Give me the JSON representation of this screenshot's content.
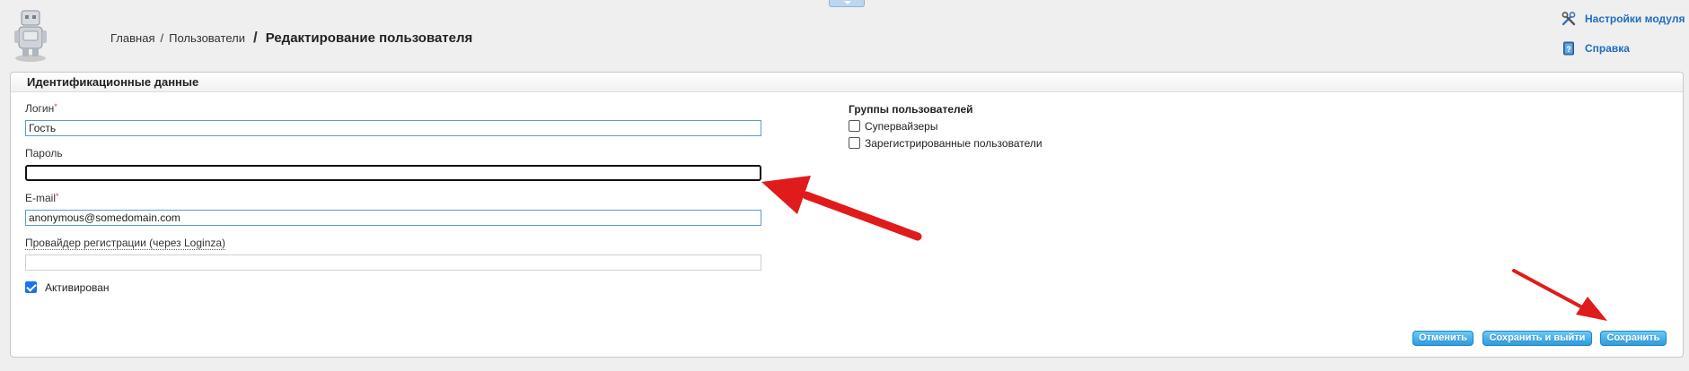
{
  "header": {
    "breadcrumb": [
      "Главная",
      "Пользователи"
    ],
    "current_page": "Редактирование пользователя",
    "links": {
      "settings": "Настройки модуля",
      "help": "Справка"
    }
  },
  "panel": {
    "title": "Идентификационные данные"
  },
  "form": {
    "login": {
      "label": "Логин",
      "required": "*",
      "value": "Гость"
    },
    "password": {
      "label": "Пароль",
      "value": ""
    },
    "email": {
      "label": "E-mail",
      "required": "*",
      "value": "anonymous@somedomain.com"
    },
    "provider": {
      "label": "Провайдер регистрации (через Loginza)",
      "value": ""
    },
    "active": {
      "label": "Активирован",
      "checked": true
    }
  },
  "groups": {
    "title": "Группы пользователей",
    "items": [
      {
        "label": "Супервайзеры",
        "checked": false
      },
      {
        "label": "Зарегистрированные пользователи",
        "checked": false
      }
    ]
  },
  "buttons": {
    "cancel": "Отменить",
    "save_exit": "Сохранить и выйти",
    "save": "Сохранить"
  },
  "colors": {
    "accent": "#1d6fc0",
    "button": "#2b9be0",
    "annotation_arrow": "#e01b1b"
  }
}
